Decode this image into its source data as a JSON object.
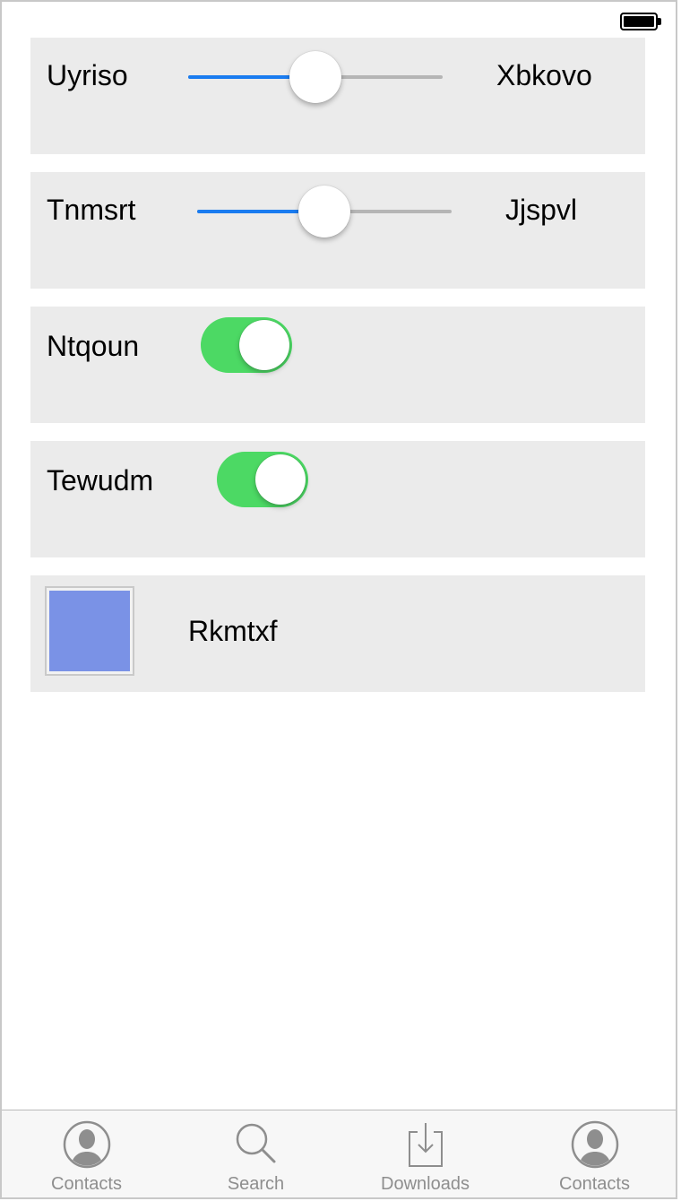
{
  "colors": {
    "slider_fill": "#1a7cf0",
    "switch_on": "#4cd964",
    "swatch": "#7a92e6",
    "tab_inactive": "#8e8e8e"
  },
  "rows": {
    "slider1": {
      "label": "Uyriso",
      "end_label": "Xbkovo",
      "value_fraction": 0.5
    },
    "slider2": {
      "label": "Tnmsrt",
      "end_label": "Jjspvl",
      "value_fraction": 0.5
    },
    "switch1": {
      "label": "Ntqoun",
      "on": true
    },
    "switch2": {
      "label": "Tewudm",
      "on": true
    },
    "color": {
      "label": "Rkmtxf",
      "swatch_color": "#7a92e6"
    }
  },
  "tabbar": {
    "tabs": [
      {
        "label": "Contacts",
        "icon": "contacts-icon"
      },
      {
        "label": "Search",
        "icon": "search-icon"
      },
      {
        "label": "Downloads",
        "icon": "downloads-icon"
      },
      {
        "label": "Contacts",
        "icon": "contacts-icon"
      }
    ]
  }
}
